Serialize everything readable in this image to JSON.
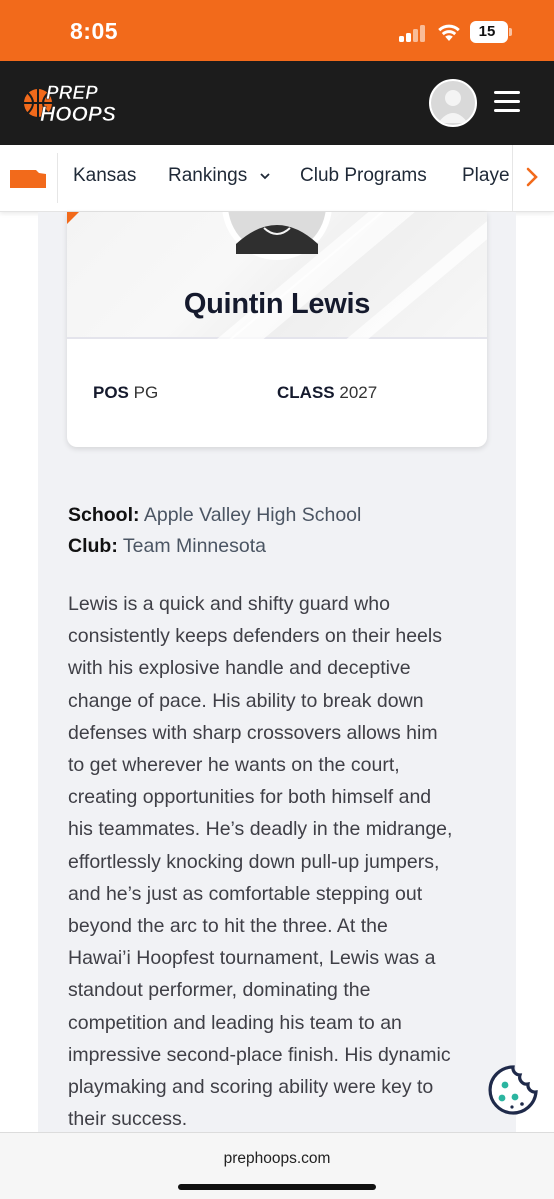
{
  "status_bar": {
    "time": "8:05",
    "battery": "15"
  },
  "header": {
    "logo_line1": "PREP",
    "logo_line2": "HOOPS"
  },
  "nav": {
    "items": [
      "Kansas",
      "Rankings",
      "Club Programs",
      "Playe"
    ],
    "rankings_has_dropdown": true
  },
  "player": {
    "name": "Quintin Lewis",
    "pos_label": "POS",
    "pos_value": "PG",
    "class_label": "CLASS",
    "class_value": "2027"
  },
  "details": {
    "school_label": "School:",
    "school_value": "Apple Valley High School",
    "club_label": "Club:",
    "club_value": "Team Minnesota"
  },
  "bio": {
    "lines": [
      "Lewis is a quick and shifty guard who",
      "consistently keeps defenders on their heels",
      "with his explosive handle and deceptive",
      "change of pace. His ability to break down",
      "defenses with sharp crossovers allows him",
      "to get wherever he wants on the court,",
      "creating opportunities for both himself and",
      "his teammates. He’s deadly in the midrange,",
      "effortlessly knocking down pull-up jumpers,",
      "and he’s just as comfortable stepping out",
      "beyond the arc to hit the three. At the",
      "Hawai’i Hoopfest tournament, Lewis was a",
      "standout performer, dominating the",
      "competition and leading his team to an",
      "impressive second-place finish. His dynamic",
      "playmaking and scoring ability were key to",
      "their success."
    ]
  },
  "browser": {
    "url": "prephoops.com"
  },
  "colors": {
    "brand_orange": "#f26a1b",
    "header_dark": "#1c1c1c",
    "panel_gray": "#f1f2f5",
    "cookie_teal": "#2bb5a0",
    "cookie_navy": "#1f2a4a"
  },
  "icons": {
    "menu": "hamburger-icon",
    "avatar": "user-avatar-icon",
    "state": "kansas-flag-icon",
    "next": "chevron-right-icon",
    "cookie": "cookie-icon"
  }
}
